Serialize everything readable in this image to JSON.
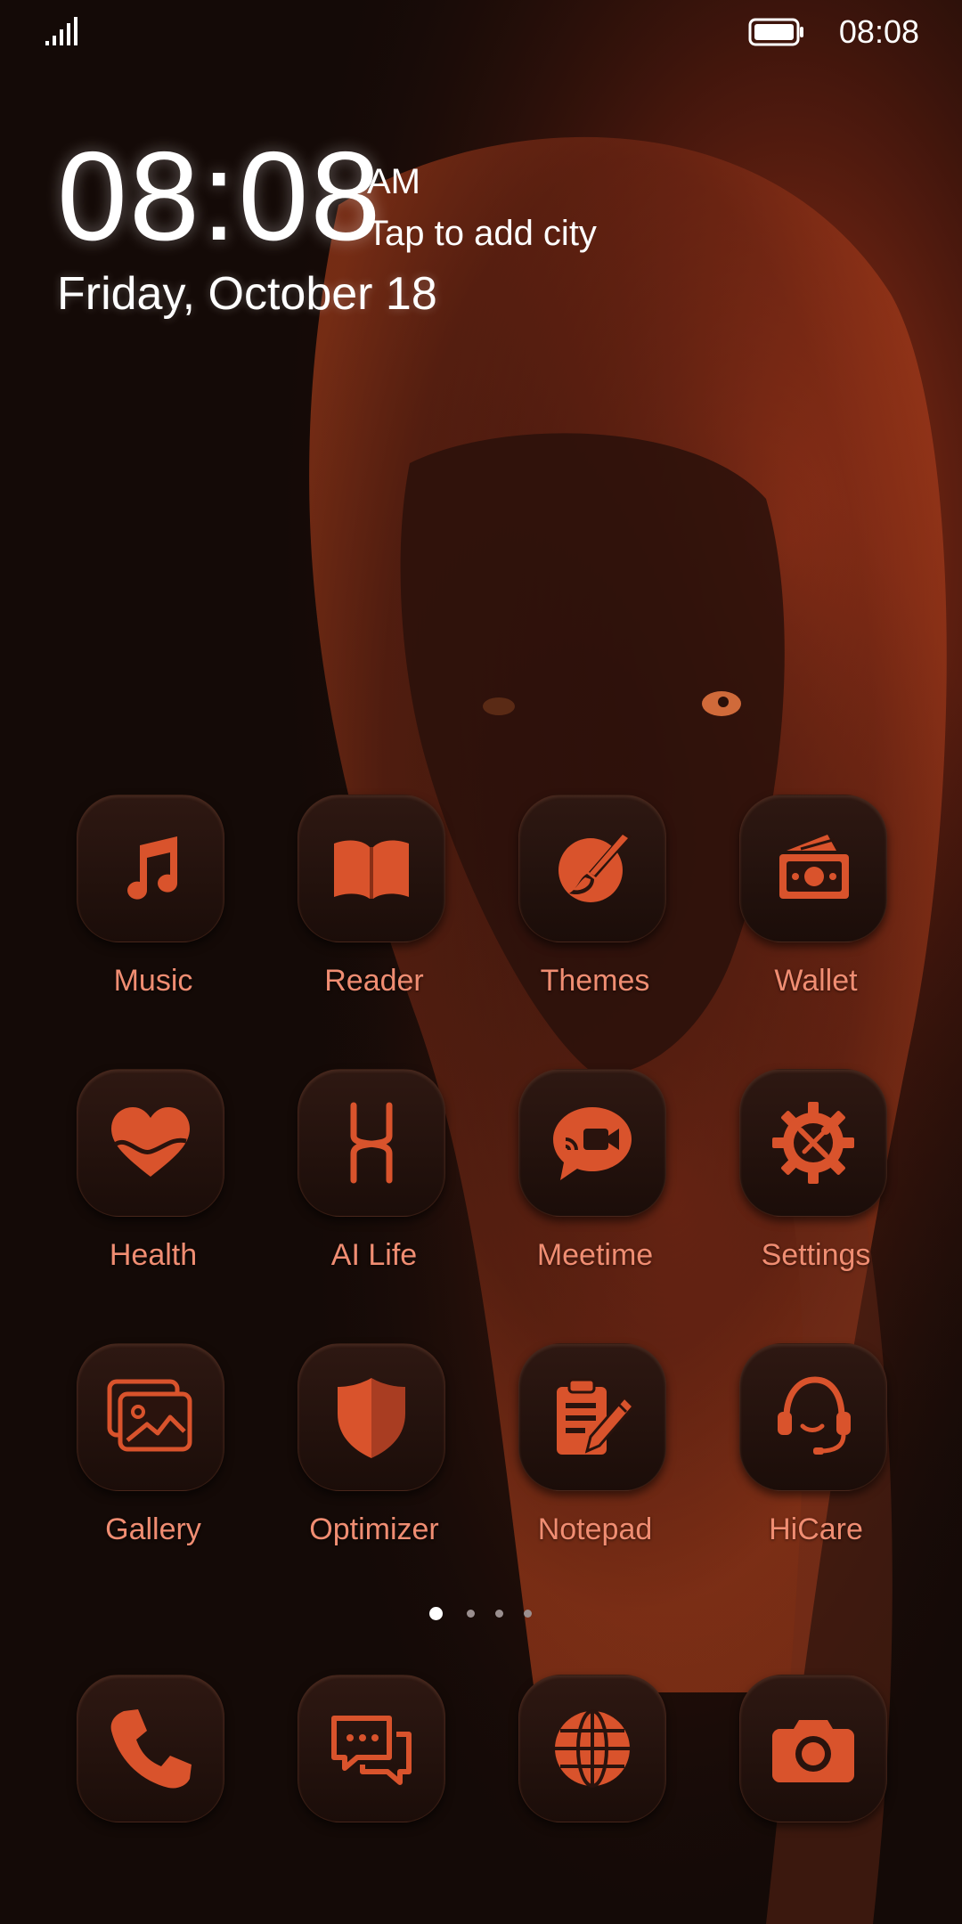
{
  "status_bar": {
    "time": "08:08"
  },
  "clock_widget": {
    "time": "08:08",
    "ampm": "AM",
    "city": "Tap to add city",
    "date": "Friday, October 18"
  },
  "apps": [
    {
      "label": "Music",
      "icon": "music-note-icon"
    },
    {
      "label": "Reader",
      "icon": "book-icon"
    },
    {
      "label": "Themes",
      "icon": "palette-brush-icon"
    },
    {
      "label": "Wallet",
      "icon": "money-icon"
    },
    {
      "label": "Health",
      "icon": "heart-icon"
    },
    {
      "label": "AI Life",
      "icon": "ai-life-icon"
    },
    {
      "label": "Meetime",
      "icon": "video-chat-icon"
    },
    {
      "label": "Settings",
      "icon": "gear-tools-icon"
    },
    {
      "label": "Gallery",
      "icon": "gallery-icon"
    },
    {
      "label": "Optimizer",
      "icon": "shield-icon"
    },
    {
      "label": "Notepad",
      "icon": "clipboard-pencil-icon"
    },
    {
      "label": "HiCare",
      "icon": "headset-icon"
    }
  ],
  "dock": [
    {
      "icon": "phone-icon"
    },
    {
      "icon": "messages-icon"
    },
    {
      "icon": "browser-globe-icon"
    },
    {
      "icon": "camera-icon"
    }
  ],
  "page_indicator": {
    "pages": 4,
    "current": 1
  },
  "colors": {
    "icon_accent": "#d9532c",
    "label": "#f08d72",
    "background": "#160b08"
  }
}
